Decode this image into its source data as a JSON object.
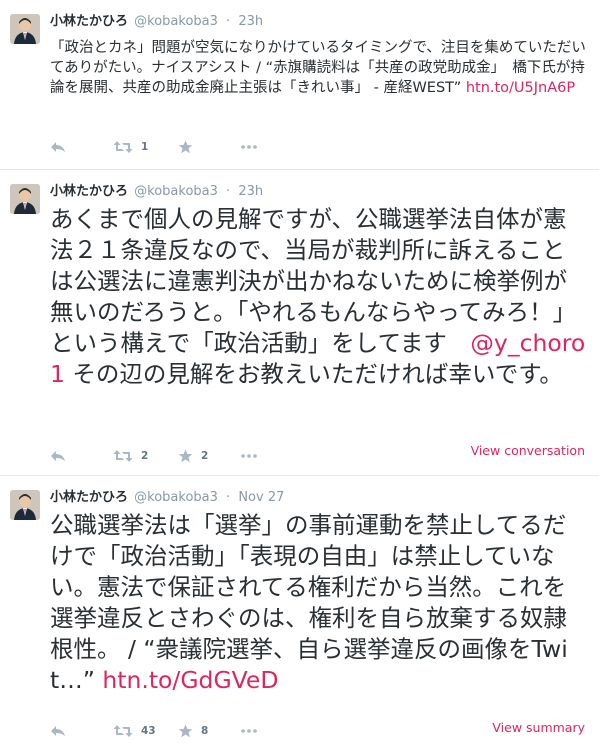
{
  "tweets": [
    {
      "name": "小林たかひろ",
      "handle": "@kobakoba3",
      "time": "23h",
      "text_plain": "「政治とカネ」問題が空気になりかけているタイミングで、注目を集めていただいてありがたい。ナイスアシスト / “赤旗購読料は「共産の政党助成金」　橋下氏が持論を展開、共産の助成金廃止主張は「きれい事」 - 産経WEST” ",
      "link": "htn.to/U5JnA6P",
      "retweets": "1",
      "favorites": ""
    },
    {
      "name": "小林たかひろ",
      "handle": "@kobakoba3",
      "time": "23h",
      "text_before": "あくまで個人の見解ですが、公職選挙法自体が憲法２１条違反なので、当局が裁判所に訴えることは公選法に違憲判決が出かねないために検挙例が無いのだろうと。「やれるもんならやってみろ！」という構えで「政治活動」をしてます　",
      "mention": "@y_choro1",
      "text_after": " その辺の見解をお教えいただければ幸いです。",
      "retweets": "2",
      "favorites": "2",
      "footer_link": "View conversation"
    },
    {
      "name": "小林たかひろ",
      "handle": "@kobakoba3",
      "time": "Nov 27",
      "text_plain": "公職選挙法は「選挙」の事前運動を禁止してるだけで「政治活動」「表現の自由」は禁止していない。憲法で保証されてる権利だから当然。これを選挙違反とさわぐのは、権利を自ら放棄する奴隷根性。 / “衆議院選挙、自ら選挙違反の画像をTwit…” ",
      "link": "htn.to/GdGVeD",
      "retweets": "43",
      "favorites": "8",
      "footer_link": "View summary"
    }
  ],
  "icons": [
    "reply-icon",
    "retweet-icon",
    "favorite-star-icon",
    "more-dots-icon"
  ],
  "colors": {
    "link": "#e0245e",
    "meta": "#8899a6",
    "text": "#292f33"
  }
}
